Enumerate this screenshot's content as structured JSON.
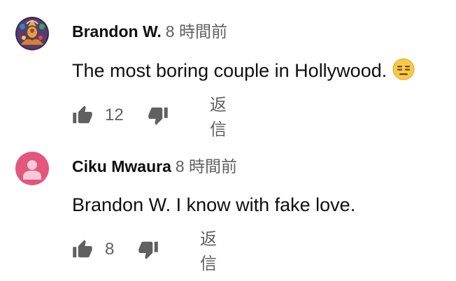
{
  "comments": [
    {
      "author": "Brandon W.",
      "time": "8 時間前",
      "text": "The most boring couple in Hollywood.",
      "emoji": "expressionless-face",
      "likes": "12",
      "reply_label": "返信",
      "avatar": "patterned-image-avatar"
    },
    {
      "author": "Ciku Mwaura",
      "time": "8 時間前",
      "text": "Brandon W. I know with fake love.",
      "likes": "8",
      "reply_label": "返信",
      "avatar": "default-person-avatar",
      "avatar_color": "#e3567e"
    }
  ]
}
